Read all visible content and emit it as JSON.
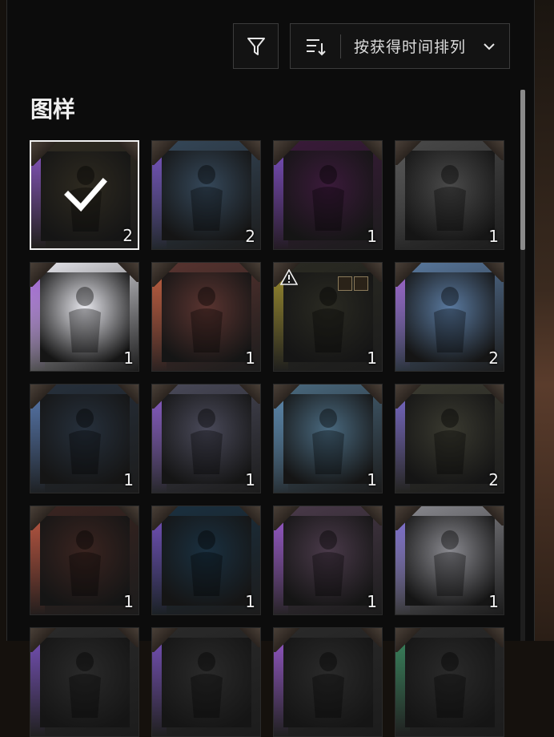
{
  "toolbar": {
    "filter_icon": "funnel-icon",
    "sort_icon": "sort-list-icon",
    "sort_label": "按获得时间排列",
    "sort_chevron": "chevron-down-icon"
  },
  "section": {
    "title": "图样"
  },
  "items": [
    {
      "count": "2",
      "rarity": "#8a56c8",
      "bg": "#2e2a20",
      "subject": "soldier-outfit-art",
      "selected": true
    },
    {
      "count": "2",
      "rarity": "#7a52c0",
      "bg": "#35485a",
      "subject": "squad-car-outfit-art"
    },
    {
      "count": "1",
      "rarity": "#7a52c0",
      "bg": "#3a1a3a",
      "subject": "three-characters-art"
    },
    {
      "count": "1",
      "rarity": "#555555",
      "bg": "#4a4a4a",
      "subject": "white-tank-top-art"
    },
    {
      "count": "1",
      "rarity": "#9a5ad0",
      "bg": "#e8e8ee",
      "subject": "white-dress-outfit-art"
    },
    {
      "count": "1",
      "rarity": "#c06040",
      "bg": "#5a3430",
      "subject": "black-motorcycle-art"
    },
    {
      "count": "1",
      "rarity": "#a09030",
      "bg": "#2a2a22",
      "subject": "gold-motorcycle-art",
      "warning": true
    },
    {
      "count": "2",
      "rarity": "#a060c8",
      "bg": "#5a7aa0",
      "subject": "beach-outfit-art"
    },
    {
      "count": "1",
      "rarity": "#5a7ab0",
      "bg": "#26303c",
      "subject": "mask-jacket-outfit-art"
    },
    {
      "count": "1",
      "rarity": "#8a5ac8",
      "bg": "#4a4a5a",
      "subject": "backpack-art"
    },
    {
      "count": "1",
      "rarity": "#5a84a8",
      "bg": "#4a6a80",
      "subject": "red-shoes-art"
    },
    {
      "count": "2",
      "rarity": "#7a6ad0",
      "bg": "#3a3a30",
      "subject": "jungle-outfit-art"
    },
    {
      "count": "1",
      "rarity": "#c05a44",
      "bg": "#3a2420",
      "subject": "duo-outfits-art"
    },
    {
      "count": "1",
      "rarity": "#7a52c0",
      "bg": "#1a3040",
      "subject": "forest-outfit-art"
    },
    {
      "count": "1",
      "rarity": "#9a5ad0",
      "bg": "#4a3a4a",
      "subject": "vest-shirt-art"
    },
    {
      "count": "1",
      "rarity": "#7a6ad0",
      "bg": "#8a8a90",
      "subject": "officer-outfit-art"
    },
    {
      "rarity": "#7a52c0",
      "bg": "#2a2a2a",
      "subject": "partial-tile"
    },
    {
      "rarity": "#7a52c0",
      "bg": "#2a2a2a",
      "subject": "partial-tile"
    },
    {
      "rarity": "#9a5ad0",
      "bg": "#2a2a2a",
      "subject": "partial-tile"
    },
    {
      "rarity": "#3a8a60",
      "bg": "#2a2a2a",
      "subject": "partial-tile"
    }
  ]
}
